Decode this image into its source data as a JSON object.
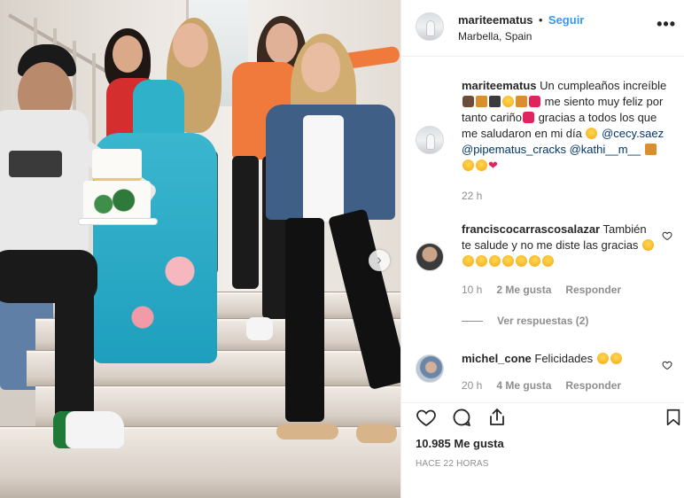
{
  "post": {
    "username": "mariteematus",
    "separator": "•",
    "follow_label": "Seguir",
    "location": "Marbella, Spain",
    "more_label": "•••"
  },
  "caption": {
    "username": "mariteematus",
    "text_1": "Un cumpleaños increíble",
    "text_2": "me siento muy feliz por tanto cariño",
    "text_3": "gracias a todos los que me saludaron en mi día",
    "mentions": [
      "@cecy.saez",
      "@pipematus_cracks",
      "@kathi__m__"
    ],
    "time": "22 h"
  },
  "comments": [
    {
      "username": "franciscocarrascosalazar",
      "text": "También te salude y no me diste las gracias",
      "time": "10 h",
      "likes": "2 Me gusta",
      "reply_label": "Responder",
      "view_replies": "Ver respuestas (2)"
    },
    {
      "username": "michel_cone",
      "text": "Felicidades",
      "time": "20 h",
      "likes": "4 Me gusta",
      "reply_label": "Responder"
    }
  ],
  "footer": {
    "likes": "10.985 Me gusta",
    "timestamp": "HACE 22 HORAS"
  },
  "icons": {
    "like": "heart-icon",
    "comment": "comment-icon",
    "share": "share-icon",
    "save": "bookmark-icon",
    "next": "chevron-right-icon",
    "more": "more-options-icon"
  },
  "colors": {
    "accent": "#3897f0",
    "text": "#262626",
    "muted": "#8e8e8e",
    "mention": "#003569",
    "border": "#efefef"
  }
}
